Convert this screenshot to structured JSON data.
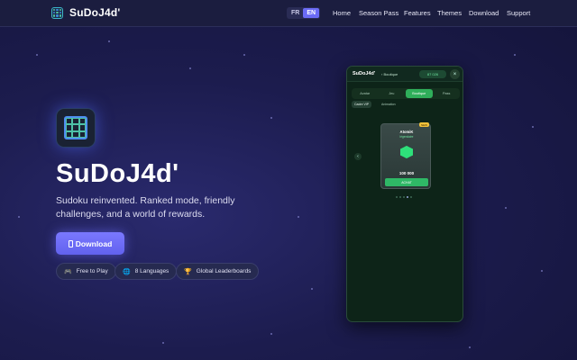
{
  "nav": {
    "brand": "SuDoJ4d'",
    "languages": [
      "FR",
      "EN"
    ],
    "active_language": "EN",
    "links": [
      "Home",
      "Season Pass",
      "Features",
      "Themes",
      "Download",
      "Support"
    ]
  },
  "hero": {
    "title": "SuDoJ4d'",
    "subtitle": "Sudoku reinvented. Ranked mode, friendly challenges, and a world of rewards.",
    "download_label": "Download",
    "features": [
      {
        "icon": "gamepad-icon",
        "label": "Free to Play"
      },
      {
        "icon": "globe-icon",
        "label": "8 Languages"
      },
      {
        "icon": "trophy-icon",
        "label": "Global Leaderboards"
      }
    ]
  },
  "phone": {
    "brand": "SuDoJ4d'",
    "crumb": "Boutique",
    "coins": "87 026",
    "tabs": [
      "Avatar",
      "Jeu",
      "Boutique",
      "Pass"
    ],
    "active_tab": "Boutique",
    "filters": [
      "Cadre VIP",
      "Animation"
    ],
    "card": {
      "badge": "NEW",
      "name": "AtomiK",
      "rarity": "légendaire",
      "price": "100 000",
      "button": "ACHAT"
    }
  },
  "colors": {
    "accent": "#6b6bf5",
    "background": "#1c1c4e",
    "shop_green": "#2fb866"
  }
}
